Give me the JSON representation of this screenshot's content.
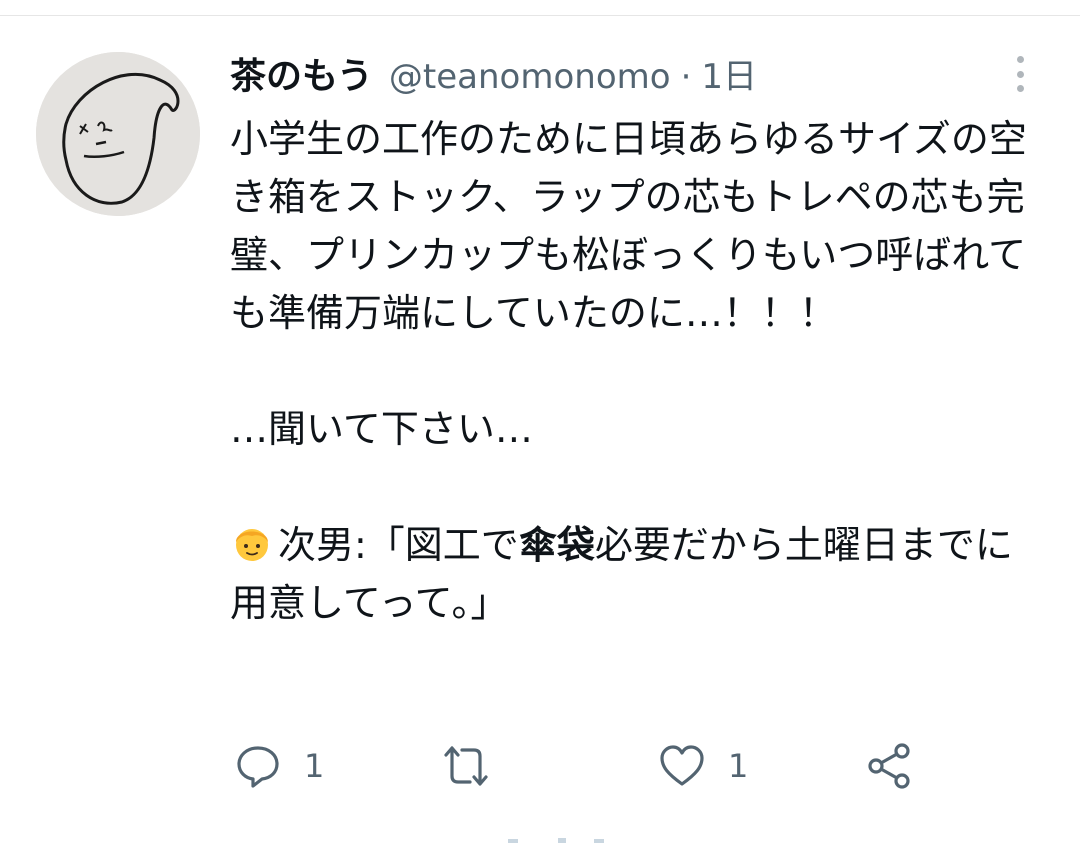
{
  "tweet": {
    "display_name": "茶のもう",
    "handle": "@teanomonomo",
    "separator": "·",
    "timestamp": "1日",
    "body": {
      "paragraph1": "小学生の工作のために日頃あらゆるサイズの空き箱をストック、ラップの芯もトレペの芯も完璧、プリンカップも松ぼっくりもいつ呼ばれても準備万端にしていたのに…！！！",
      "paragraph2": "…聞いて下さい…",
      "paragraph3_prefix": "次男:「図工で",
      "paragraph3_bold": "傘袋",
      "paragraph3_suffix": "必要だから土曜日までに用意してって。」"
    },
    "emoji": "boy-emoji"
  },
  "actions": {
    "reply_count": "1",
    "like_count": "1"
  },
  "colors": {
    "text_primary": "#0f1419",
    "text_secondary": "#536471",
    "divider": "#e6e6e6",
    "avatar_bg": "#e4e2df"
  },
  "icons": [
    "more-vertical-icon",
    "reply-icon",
    "retweet-icon",
    "like-icon",
    "share-icon"
  ]
}
